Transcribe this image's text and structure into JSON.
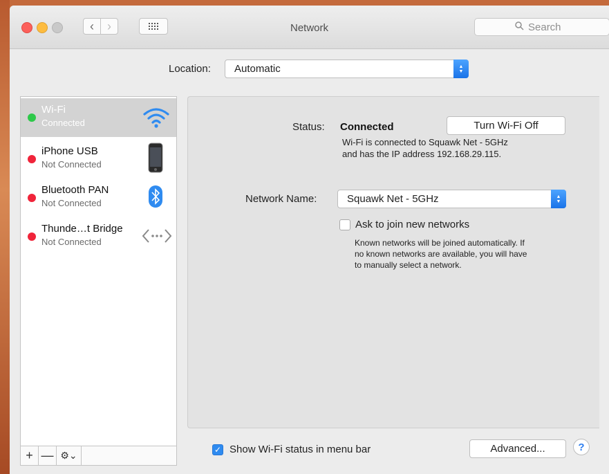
{
  "window": {
    "title": "Network"
  },
  "toolbar": {
    "back_icon": "chevron-left-icon",
    "forward_icon": "chevron-right-icon",
    "show_all_icon": "grid-icon",
    "search_placeholder": "Search"
  },
  "location": {
    "label": "Location:",
    "value": "Automatic"
  },
  "services": [
    {
      "name": "Wi-Fi",
      "status": "Connected",
      "dot_color": "#2ec94a",
      "icon": "wifi-icon",
      "selected": true
    },
    {
      "name": "iPhone USB",
      "status": "Not Connected",
      "dot_color": "#f0243a",
      "icon": "iphone-icon",
      "selected": false
    },
    {
      "name": "Bluetooth PAN",
      "status": "Not Connected",
      "dot_color": "#f0243a",
      "icon": "bluetooth-icon",
      "selected": false
    },
    {
      "name": "Thunde…t Bridge",
      "status": "Not Connected",
      "dot_color": "#f0243a",
      "icon": "thunderbolt-bridge-icon",
      "selected": false
    }
  ],
  "sidebar_tools": {
    "add": "+",
    "remove": "—",
    "actions_icon": "gear-icon"
  },
  "detail": {
    "status_label": "Status:",
    "status_value": "Connected",
    "turn_off_button": "Turn Wi-Fi Off",
    "status_desc_line1": "Wi-Fi is connected to Squawk Net - 5GHz",
    "status_desc_line2": "and has the IP address 192.168.29.115.",
    "network_name_label": "Network Name:",
    "network_name_value": "Squawk Net - 5GHz",
    "ask_join_label": "Ask to join new networks",
    "ask_join_checked": false,
    "ask_desc_line1": "Known networks will be joined automatically. If",
    "ask_desc_line2": "no known networks are available, you will have",
    "ask_desc_line3": "to manually select a network."
  },
  "footer": {
    "show_status_label": "Show Wi-Fi status in menu bar",
    "show_status_checked": true,
    "advanced_button": "Advanced...",
    "help_button": "?"
  },
  "colors": {
    "accent": "#2f8bf0",
    "connected": "#2ec94a",
    "disconnected": "#f0243a"
  }
}
